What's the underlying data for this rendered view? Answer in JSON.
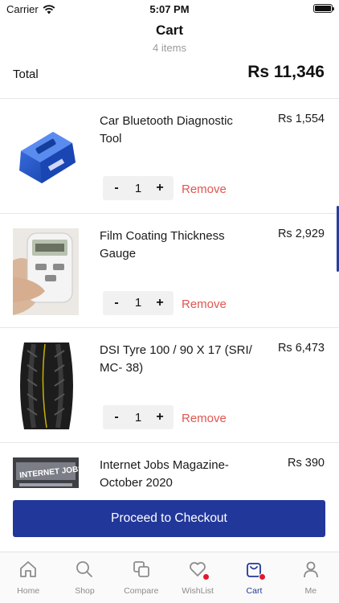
{
  "status_bar": {
    "carrier": "Carrier",
    "time": "5:07 PM"
  },
  "header": {
    "title": "Cart",
    "subtitle": "4 items"
  },
  "total": {
    "label": "Total",
    "value": "Rs 11,346"
  },
  "items": [
    {
      "name": "Car Bluetooth Diagnostic Tool",
      "price": "Rs 1,554",
      "quantity": "1",
      "remove": "Remove",
      "minus": "-",
      "plus": "+"
    },
    {
      "name": "Film Coating Thickness Gauge",
      "price": "Rs 2,929",
      "quantity": "1",
      "remove": "Remove",
      "minus": "-",
      "plus": "+"
    },
    {
      "name": "DSI Tyre 100 / 90 X 17 (SRI/ MC- 38)",
      "price": "Rs 6,473",
      "quantity": "1",
      "remove": "Remove",
      "minus": "-",
      "plus": "+"
    },
    {
      "name": "Internet Jobs Magazine- October 2020",
      "price": "Rs 390",
      "thumb_text": "INTERNET JOBS"
    }
  ],
  "checkout": {
    "label": "Proceed to Checkout"
  },
  "tabs": [
    {
      "label": "Home",
      "icon": "home-icon"
    },
    {
      "label": "Shop",
      "icon": "search-icon"
    },
    {
      "label": "Compare",
      "icon": "compare-icon"
    },
    {
      "label": "WishList",
      "icon": "heart-icon",
      "badge": true
    },
    {
      "label": "Cart",
      "icon": "cart-icon",
      "badge": true,
      "active": true
    },
    {
      "label": "Me",
      "icon": "person-icon"
    }
  ],
  "colors": {
    "primary": "#22379a",
    "remove": "#e25550",
    "badge": "#e0192f"
  }
}
